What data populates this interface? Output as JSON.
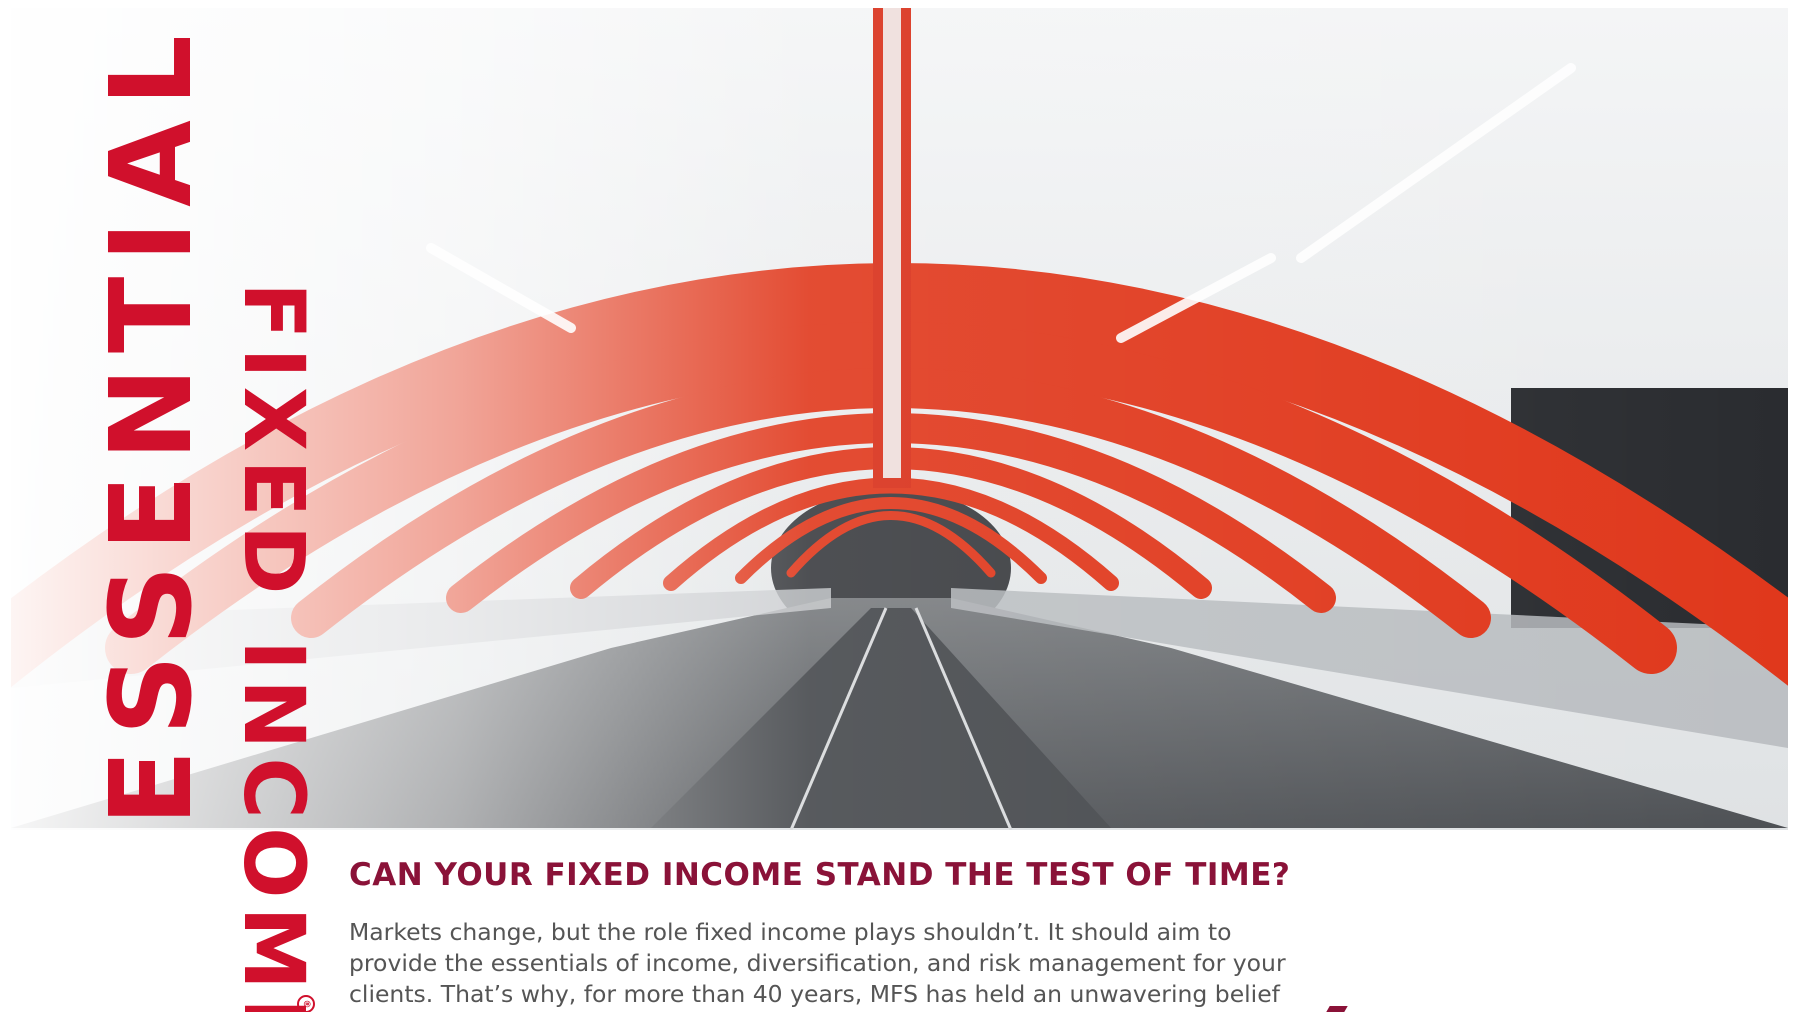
{
  "brand": {
    "word1": "ESSENTIAL",
    "word2": "FIXED INCOME",
    "registered_symbol": "®",
    "colors": {
      "red": "#d0102c",
      "dark_red": "#8a1238"
    }
  },
  "hero": {
    "subject": "red arched pedestrian bridge at night",
    "colors": {
      "arch": "#e0381c",
      "sky": "#eceeef",
      "deck": "#5c5f63"
    }
  },
  "headline": "CAN YOUR FIXED INCOME STAND THE TEST OF TIME?",
  "body_lines": [
    "Markets change, but the role fixed income plays shouldn’t. It should aim to",
    "provide the essentials of income, diversification, and risk management for your",
    "clients. That’s why, for more than 40 years, MFS has held an unwavering belief"
  ]
}
